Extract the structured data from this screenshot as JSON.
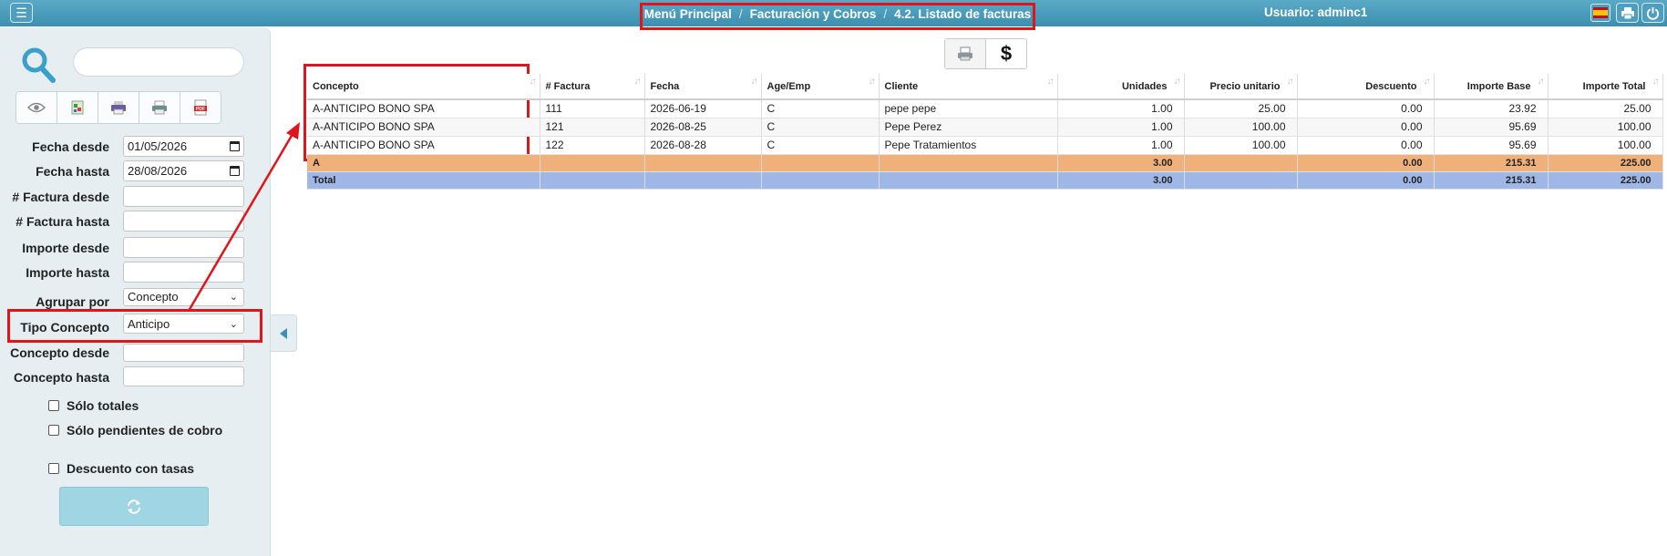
{
  "topbar": {
    "breadcrumb": [
      "Menú Principal",
      "Facturación y Cobros",
      "4.2. Listado de facturas"
    ],
    "user_label": "Usuario: adminc1"
  },
  "sidebar": {
    "search": {
      "value": "",
      "placeholder": ""
    },
    "toolbar_icons": [
      "eye-icon",
      "excel-icon",
      "print-icon",
      "printer-icon",
      "pdf-icon"
    ],
    "filters": {
      "fecha_desde": {
        "label": "Fecha desde",
        "value": "01/05/2026"
      },
      "fecha_hasta": {
        "label": "Fecha hasta",
        "value": "28/08/2026"
      },
      "factura_desde": {
        "label": "# Factura desde",
        "value": ""
      },
      "factura_hasta": {
        "label": "# Factura hasta",
        "value": ""
      },
      "importe_desde": {
        "label": "Importe desde",
        "value": ""
      },
      "importe_hasta": {
        "label": "Importe hasta",
        "value": ""
      },
      "agrupar_por": {
        "label": "Agrupar por",
        "value": "Concepto"
      },
      "tipo_concepto": {
        "label": "Tipo Concepto",
        "value": "Anticipo"
      },
      "concepto_desde": {
        "label": "Concepto desde",
        "value": ""
      },
      "concepto_hasta": {
        "label": "Concepto hasta",
        "value": ""
      }
    },
    "checkboxes": {
      "solo_totales": "Sólo totales",
      "solo_pendientes": "Sólo pendientes de cobro",
      "descuento_tasas": "Descuento con tasas"
    }
  },
  "currency_toggle": {
    "symbol": "$"
  },
  "table": {
    "headers": [
      "Concepto",
      "# Factura",
      "Fecha",
      "Age/Emp",
      "Cliente",
      "Unidades",
      "Precio unitario",
      "Descuento",
      "Importe Base",
      "Importe Total"
    ],
    "rows": [
      [
        "A-ANTICIPO BONO SPA",
        "111",
        "2026-06-19",
        "C",
        "pepe pepe",
        "1.00",
        "25.00",
        "0.00",
        "23.92",
        "25.00"
      ],
      [
        "A-ANTICIPO BONO SPA",
        "121",
        "2026-08-25",
        "C",
        "Pepe Perez",
        "1.00",
        "100.00",
        "0.00",
        "95.69",
        "100.00"
      ],
      [
        "A-ANTICIPO BONO SPA",
        "122",
        "2026-08-28",
        "C",
        "Pepe Tratamientos",
        "1.00",
        "100.00",
        "0.00",
        "95.69",
        "100.00"
      ]
    ],
    "group": {
      "label": "A",
      "unidades": "3.00",
      "descuento": "0.00",
      "importe_base": "215.31",
      "importe_total": "225.00"
    },
    "total": {
      "label": "Total",
      "unidades": "3.00",
      "descuento": "0.00",
      "importe_base": "215.31",
      "importe_total": "225.00"
    }
  },
  "colors": {
    "topbar": "#4a9cbd",
    "annotation_red": "#e0141b",
    "group_row": "#f0b07a",
    "total_row": "#9fb7e6"
  }
}
